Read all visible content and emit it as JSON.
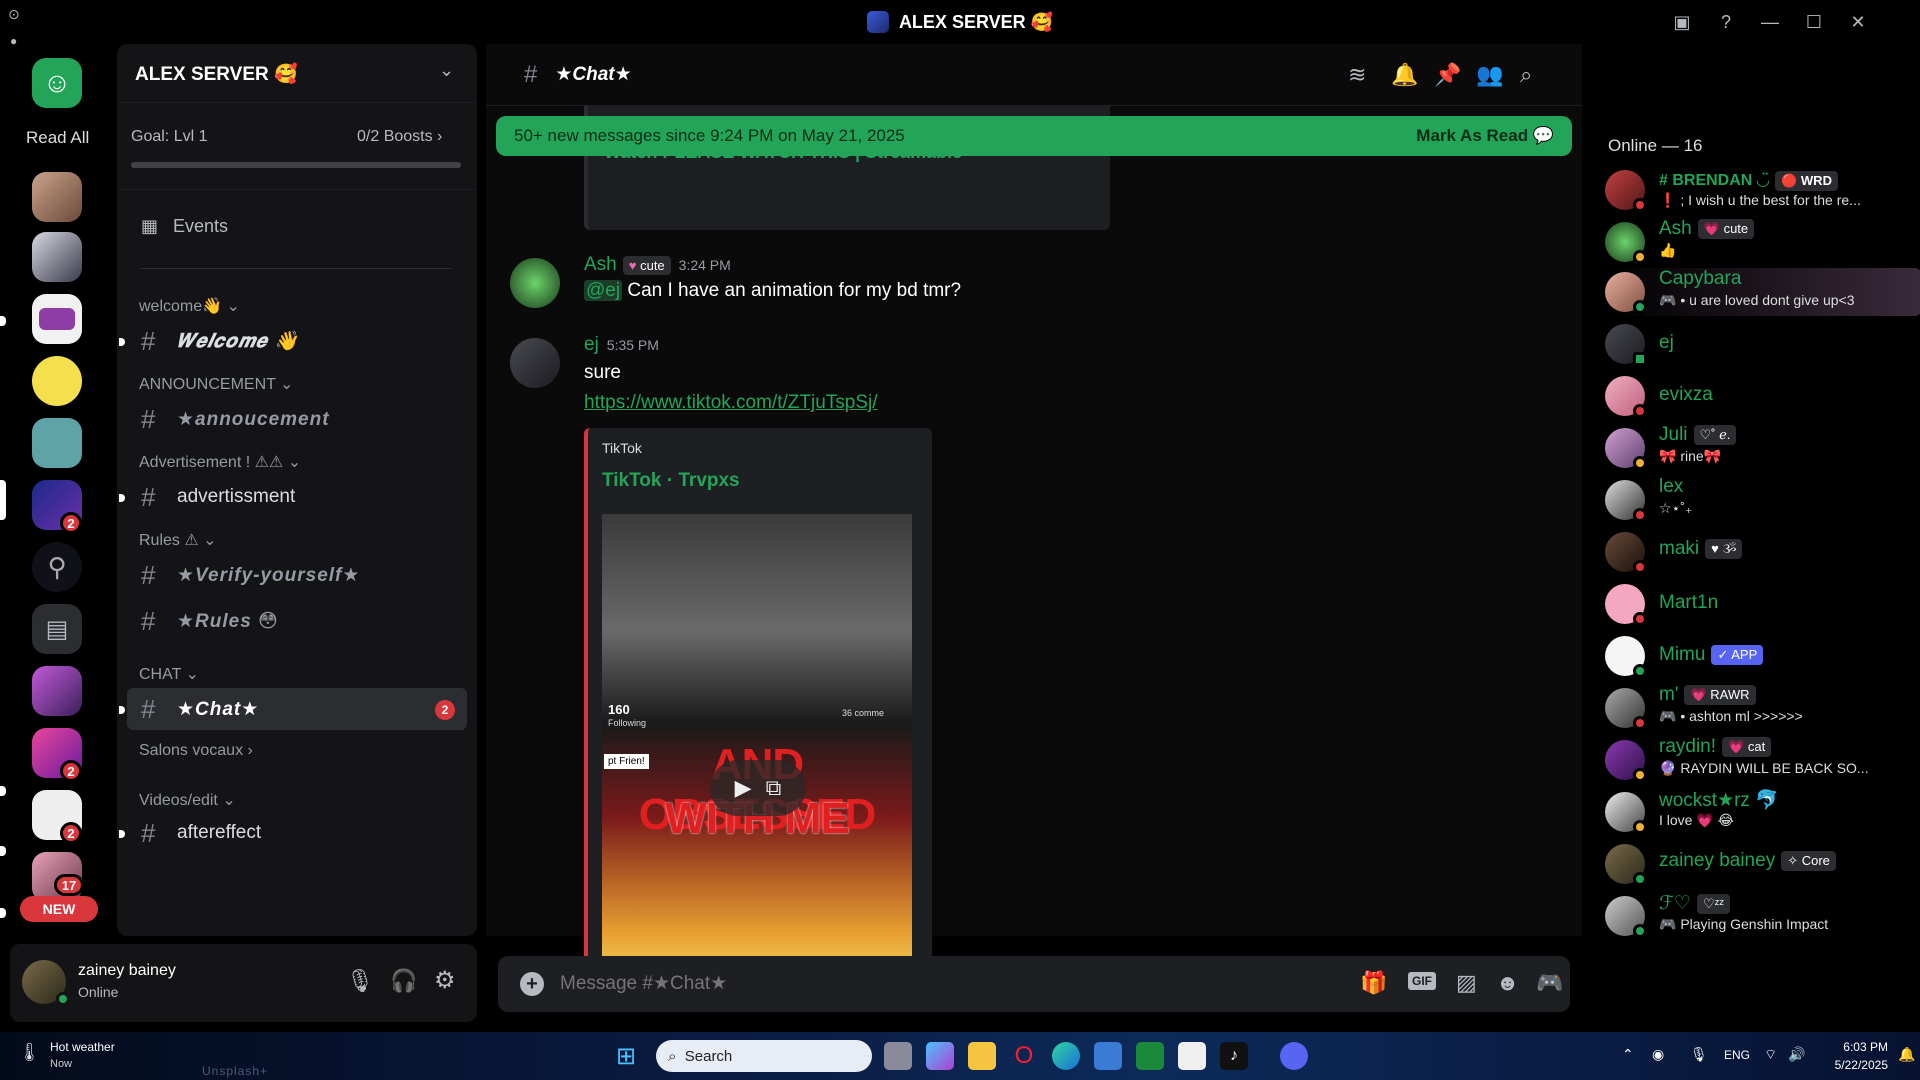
{
  "window": {
    "title": "ALEX SERVER 🥰"
  },
  "rail": {
    "read_all": "Read All",
    "badges": [
      "2",
      "2",
      "2",
      "17"
    ],
    "new_label": "NEW"
  },
  "sidebar": {
    "server_name": "ALEX SERVER 🥰",
    "goal": "Goal: Lvl 1",
    "boosts": "0/2 Boosts",
    "events": "Events",
    "categories": [
      "welcome👋",
      "ANNOUNCEMENT",
      "Advertisement ! ⚠⚠",
      "Rules ⚠",
      "CHAT",
      "Salons vocaux",
      "Videos/edit"
    ],
    "channels": {
      "welcome": "𝑾𝒆𝒍𝒄𝒐𝒎𝒆 👋",
      "announcement": "★annoucement",
      "advertisment": "advertissment",
      "verify": "★Verify-yourself★",
      "rules": "★Rules 😳",
      "chat": "★Chat★",
      "chat_badge": "2",
      "aftereffect": "aftereffect"
    }
  },
  "chat": {
    "channel_name": "★Chat★",
    "partial_embed_title": "Watch PLEASE WATCH THIS | Streamable",
    "banner_text": "50+ new messages since 9:24 PM on May 21, 2025",
    "banner_action": "Mark As Read",
    "messages": [
      {
        "author": "Ash",
        "tag": "cute",
        "time": "3:24 PM",
        "mention": "@ej",
        "text": "Can I have an animation for my bd tmr?"
      },
      {
        "author": "ej",
        "time": "5:35 PM",
        "text": "sure",
        "link": "https://www.tiktok.com/t/ZTjuTspSj/"
      }
    ],
    "embed": {
      "provider": "TikTok",
      "title": "TikTok · Trvpxs",
      "caption_top": "160",
      "caption_following": "Following",
      "caption_comments": "36 comme",
      "caption_friend": "pt Frien!",
      "overlay_line1": "AND OBSESSED",
      "overlay_line2": "WITH ME"
    },
    "composer_placeholder": "Message #★Chat★"
  },
  "members": {
    "header": "Online — 16",
    "list": [
      {
        "name": "# BRENDAN ◡̈",
        "tag": "WRD",
        "sub": "❗ ; I wish u the best for the re..."
      },
      {
        "name": "Ash",
        "tag": "cute",
        "sub": "👍"
      },
      {
        "name": "Capybara",
        "tag": "",
        "sub": "🎮 • u are loved dont give up<3"
      },
      {
        "name": "ej",
        "tag": "",
        "sub": ""
      },
      {
        "name": "evixza",
        "tag": "",
        "sub": ""
      },
      {
        "name": "Juli",
        "tag": "♡˚ ℯ.",
        "sub": "🎀 rine🎀"
      },
      {
        "name": "lex",
        "tag": "",
        "sub": "☆⋆˚₊"
      },
      {
        "name": "maki",
        "tag": "ૐ",
        "sub": ""
      },
      {
        "name": "Mart1n",
        "tag": "",
        "sub": ""
      },
      {
        "name": "Mimu",
        "tag": "✓ APP",
        "sub": ""
      },
      {
        "name": "m'",
        "tag": "RAWR",
        "sub": "🎮 • ashton ml >>>>>>"
      },
      {
        "name": "raydin!",
        "tag": "cat",
        "sub": "🔮 RAYDIN WILL BE BACK SO..."
      },
      {
        "name": "wockst★rz 🐬",
        "tag": "",
        "sub": "I love 💗 😂"
      },
      {
        "name": "zainey bainey",
        "tag": "✧ Core",
        "sub": ""
      },
      {
        "name": "ℱ♡",
        "tag": "♡ᶻᶻ",
        "sub": "🎮 Playing Genshin Impact"
      }
    ]
  },
  "user": {
    "name": "zainey bainey",
    "status": "Online"
  },
  "taskbar": {
    "weather_title": "Hot weather",
    "weather_sub": "Now",
    "search": "Search",
    "lang": "ENG",
    "time": "6:03 PM",
    "date": "5/22/2025",
    "watermark": "Unsplash+"
  },
  "colors": {
    "accent": "#23a559",
    "badge": "#da373c",
    "background": "#000000",
    "sidebar": "#141416"
  }
}
